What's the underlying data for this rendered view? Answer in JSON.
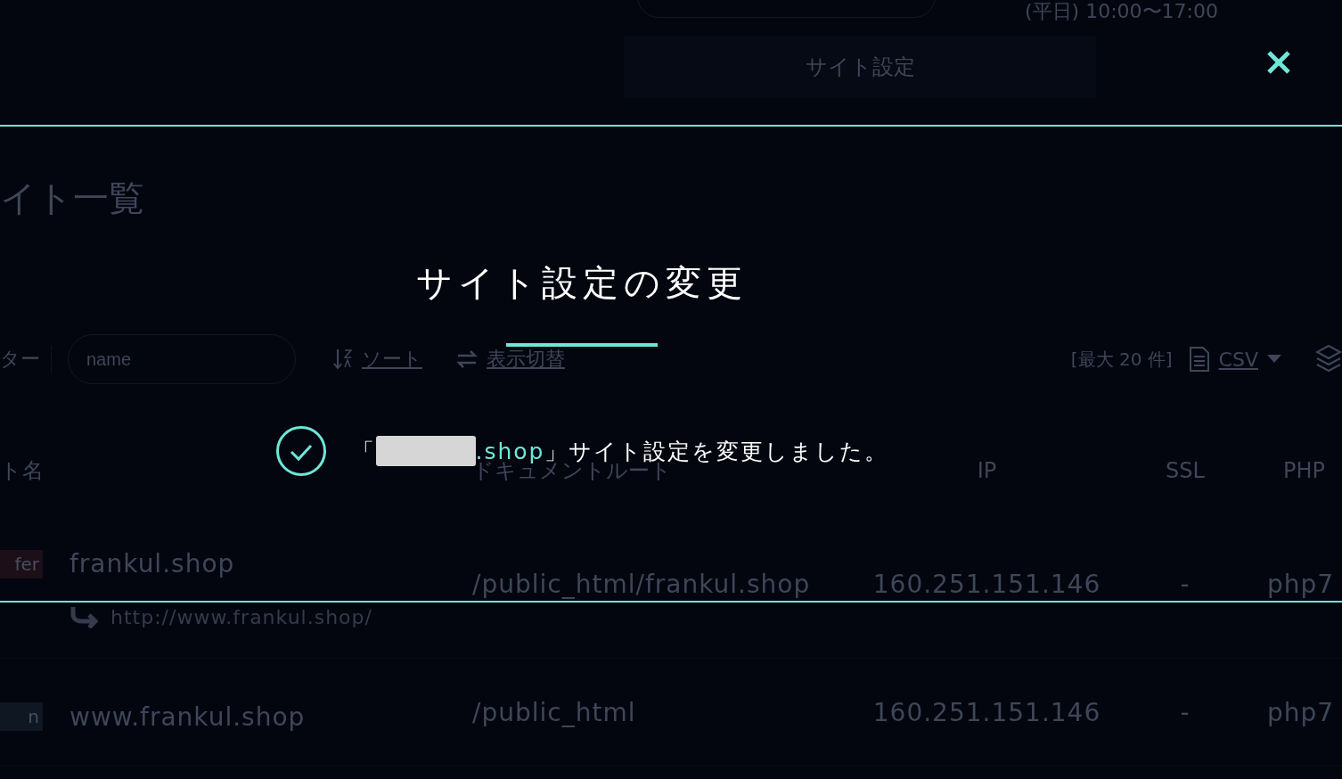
{
  "header": {
    "hours": "(平日) 10:00〜17:00",
    "tab": "サイト設定"
  },
  "page": {
    "title": "イト一覧"
  },
  "toolbar": {
    "filter_label": "ター",
    "search": {
      "placeholder": "name"
    },
    "sort": "ソート",
    "view_toggle": "表示切替",
    "limit": "[最大 20 件]",
    "csv": "CSV"
  },
  "table": {
    "columns": [
      "ト名",
      "ドキュメントルート",
      "IP",
      "SSL",
      "PHP"
    ],
    "rows": [
      {
        "badge": {
          "label": "fer",
          "color": "#1c0f18"
        },
        "domain": "frankul.shop",
        "redirect": "http://www.frankul.shop/",
        "document_root": "/public_html/frankul.shop",
        "ip": "160.251.151.146",
        "ssl": "-",
        "php": "php7"
      },
      {
        "badge": {
          "label": "n",
          "color": "#0e1722"
        },
        "domain": "www.frankul.shop",
        "document_root": "/public_html",
        "ip": "160.251.151.146",
        "ssl": "-",
        "php": "php7"
      }
    ]
  },
  "modal": {
    "title": "サイト設定の変更",
    "message": {
      "open": "「",
      "domain": ".shop",
      "rest": "」サイト設定を変更しました。"
    }
  }
}
